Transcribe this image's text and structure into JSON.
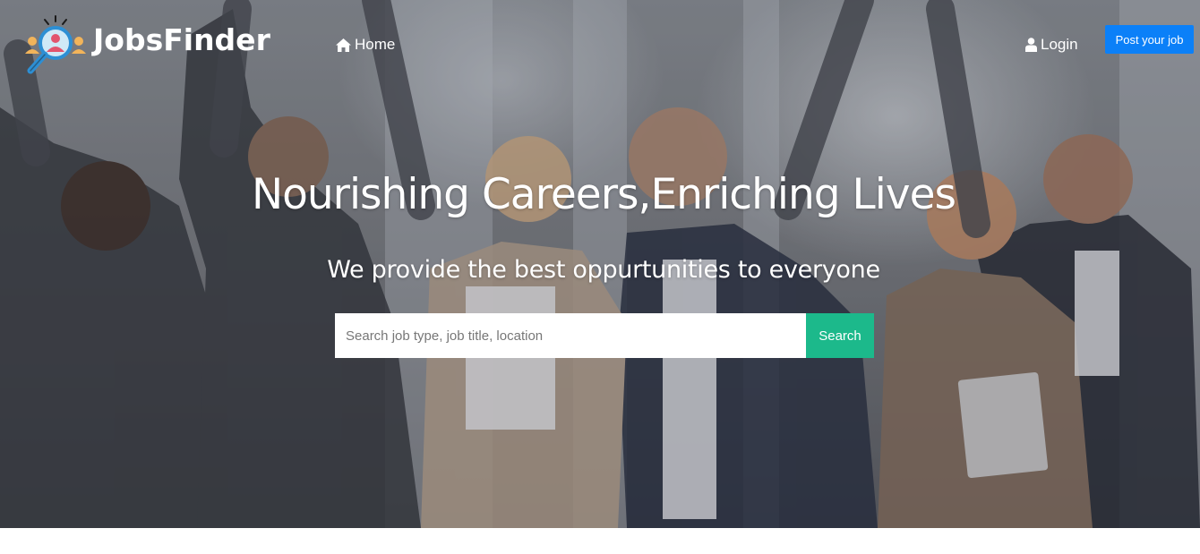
{
  "brand": {
    "name": "JobsFinder",
    "logo_icon": "magnifier-people-icon"
  },
  "nav": {
    "home_label": "Home",
    "home_icon": "home-icon",
    "login_label": "Login",
    "login_icon": "user-icon",
    "post_job_label": "Post your job"
  },
  "hero": {
    "headline": "Nourishing Careers,Enriching Lives",
    "subheadline": "We provide the best oppurtunities to everyone",
    "background": "photo-of-cheering-business-team"
  },
  "search": {
    "placeholder": "Search job type, job title, location",
    "value": "",
    "button_label": "Search"
  },
  "colors": {
    "post_button": "#0b80f8",
    "search_button": "#1cb98b",
    "text": "#ffffff"
  }
}
